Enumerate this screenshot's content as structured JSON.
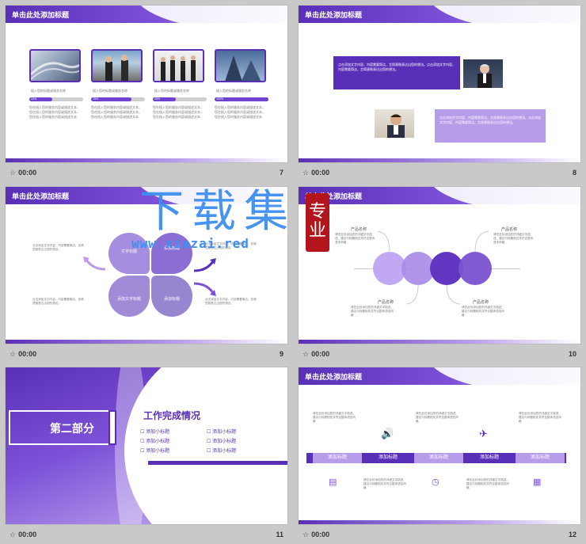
{
  "slides": [
    {
      "number": "7",
      "time": "00:00",
      "title": "单击此处添加标题",
      "items": [
        {
          "caption": "插入您的标题或服务名称",
          "progress": "43%",
          "value": 0.43,
          "body": "您在插入您的服务内容或描述文本，您在插入您的服务内容或描述文本，您在插入您的服务内容或描述文本"
        },
        {
          "caption": "插入您的标题或服务名称",
          "progress": "75%",
          "value": 0.75,
          "body": "您在插入您的服务内容或描述文本，您在插入您的服务内容或描述文本，您在插入您的服务内容或描述文本"
        },
        {
          "caption": "插入您的标题或服务名称",
          "progress": "43%",
          "value": 0.43,
          "body": "您在插入您的服务内容或描述文本，您在插入您的服务内容或描述文本，您在插入您的服务内容或描述文本"
        },
        {
          "caption": "插入您的标题或服务名称",
          "progress": "100%",
          "value": 1.0,
          "body": "您在插入您的服务内容或描述文本，您在插入您的服务内容或描述文本，您在插入您的服务内容或描述文本"
        }
      ]
    },
    {
      "number": "8",
      "time": "00:00",
      "title": "单击此处添加标题",
      "text1": "点击添加文字内容，内容需要简洁，言简意赅表达出您的想法。点击添加文字内容，内容需要简洁，言简意赅表达出您的想法。",
      "text2": "点击添加文字内容，内容需要简洁，言简意赅表达出您的想法。点击添加文字内容，内容需要简洁，言简意赅表达出您的想法。"
    },
    {
      "number": "9",
      "time": "00:00",
      "title": "单击此处添加标题",
      "petals": [
        "文字标题",
        "添加标题",
        "添加文字标题",
        "添加标题"
      ],
      "notes": [
        "点击添加文字内容，内容需要简洁，言简意赅表达出您的想法。",
        "点击添加文字内容，内容需要简洁，言简意赅表达出您的想法。",
        "点击添加文字内容，内容需要简洁，言简意赅表达出您的想法。",
        "点击添加文字内容，内容需要简洁，言简意赅表达出您的想法。"
      ]
    },
    {
      "number": "10",
      "time": "00:00",
      "title": "单击此处添加标题",
      "products": [
        "产品名称",
        "产品名称",
        "产品名称",
        "产品名称"
      ],
      "desc": "请在此处添加您的详细文字描述，建议与标题相关并符合整体语言风格"
    },
    {
      "number": "11",
      "time": "00:00",
      "section": "第二部分",
      "heading": "工作完成情况",
      "checks": [
        "添加小标题",
        "添加小标题",
        "添加小标题",
        "添加小标题",
        "添加小标题",
        "添加小标题"
      ]
    },
    {
      "number": "12",
      "time": "00:00",
      "title": "单击此处添加标题",
      "steps": [
        "添加标题",
        "添加标题",
        "添加标题",
        "添加标题",
        "添加标题"
      ],
      "desc": "请在此处添加您的详细文字描述，建议与标题相关并符合整体语言风格"
    }
  ],
  "watermark": {
    "big": "下载集",
    "url": "www.xiazai.red",
    "seal": "专业"
  },
  "colors": {
    "primary": "#5a2fb8",
    "light": "#b79cea",
    "accent": "#7d52d8"
  }
}
